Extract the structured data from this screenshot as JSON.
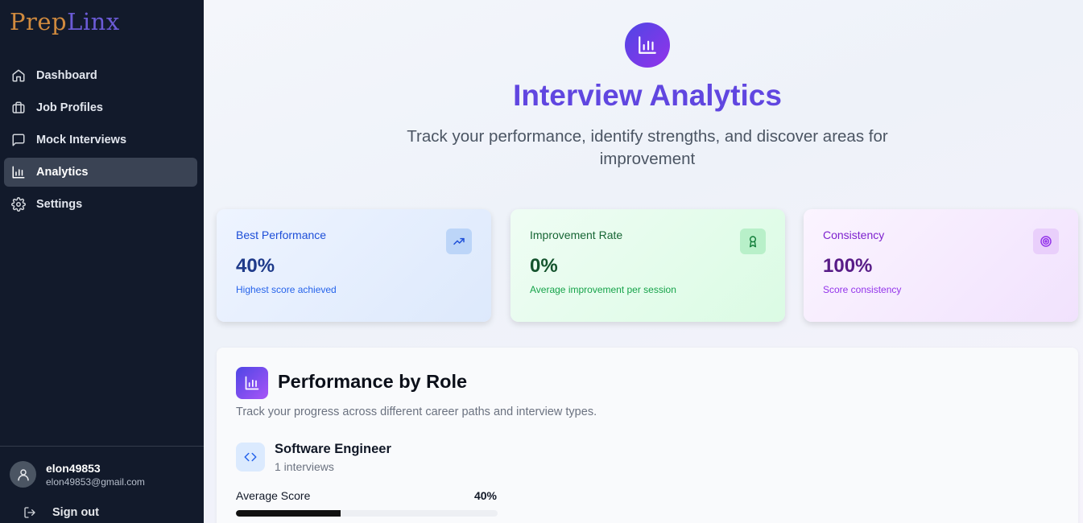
{
  "app": {
    "logo_part1": "Prep",
    "logo_part2": "Linx"
  },
  "sidebar": {
    "items": [
      {
        "label": "Dashboard",
        "icon": "home-icon",
        "active": false
      },
      {
        "label": "Job Profiles",
        "icon": "briefcase-icon",
        "active": false
      },
      {
        "label": "Mock Interviews",
        "icon": "message-square-icon",
        "active": false
      },
      {
        "label": "Analytics",
        "icon": "bar-chart-icon",
        "active": true
      },
      {
        "label": "Settings",
        "icon": "gear-icon",
        "active": false
      }
    ],
    "user": {
      "name": "elon49853",
      "email": "elon49853@gmail.com"
    },
    "signout_label": "Sign out"
  },
  "hero": {
    "title": "Interview Analytics",
    "subtitle": "Track your performance, identify strengths, and discover areas for improvement"
  },
  "stats": [
    {
      "label": "Best Performance",
      "value": "40%",
      "desc": "Highest score achieved",
      "icon": "trending-up-icon",
      "accent": "#2563eb"
    },
    {
      "label": "Improvement Rate",
      "value": "0%",
      "desc": "Average improvement per session",
      "icon": "award-icon",
      "accent": "#16a34a"
    },
    {
      "label": "Consistency",
      "value": "100%",
      "desc": "Score consistency",
      "icon": "target-icon",
      "accent": "#9333ea"
    }
  ],
  "performance": {
    "title": "Performance by Role",
    "subtitle": "Track your progress across different career paths and interview types.",
    "roles": [
      {
        "name": "Software Engineer",
        "count_text": "1 interviews",
        "score_label": "Average Score",
        "score_text": "40%",
        "score_fraction": 0.4,
        "icon": "code-icon"
      }
    ]
  },
  "colors": {
    "sidebar_bg": "#121a2b",
    "accent": "#6046e0",
    "active_nav_bg": "#3a4354"
  }
}
